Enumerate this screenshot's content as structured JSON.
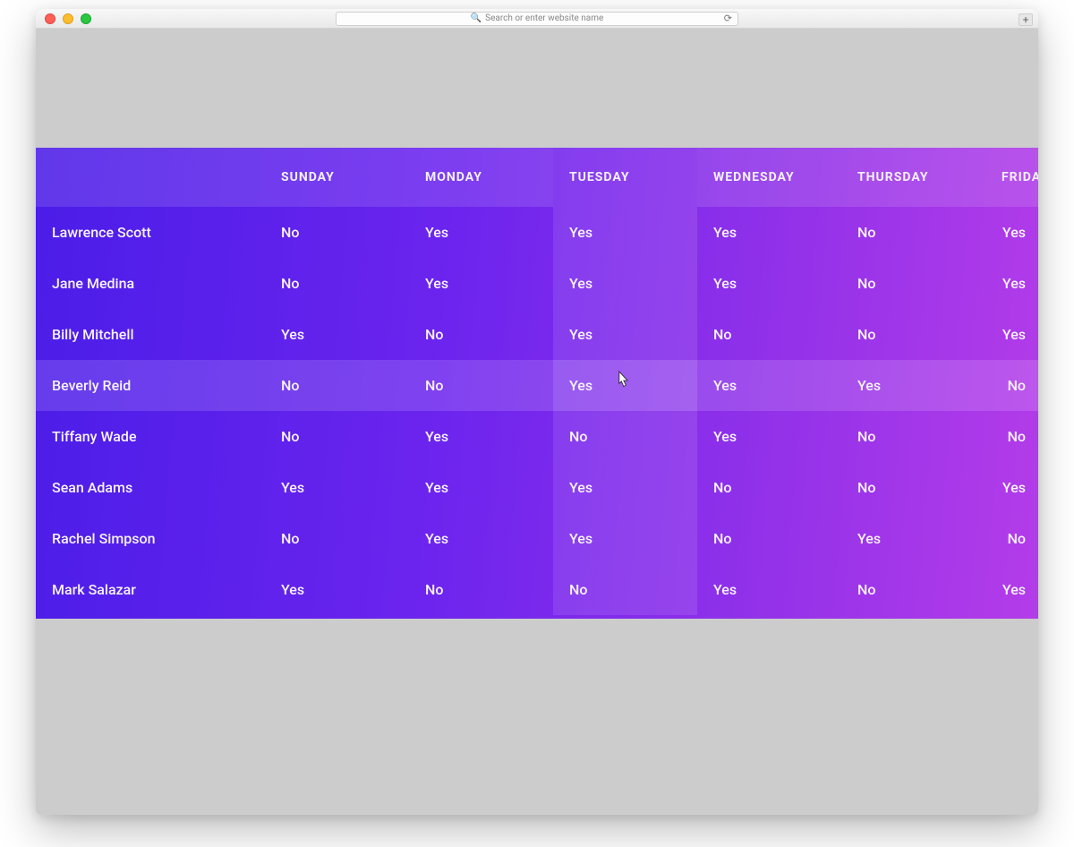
{
  "browser": {
    "url_placeholder": "Search or enter website name"
  },
  "table": {
    "highlighted_row_index": 3,
    "highlighted_col_index": 3,
    "headers": [
      "",
      "SUNDAY",
      "MONDAY",
      "TUESDAY",
      "WEDNESDAY",
      "THURSDAY",
      "FRIDAY"
    ],
    "rows": [
      {
        "name": "Lawrence Scott",
        "cells": [
          "No",
          "Yes",
          "Yes",
          "Yes",
          "No",
          "Yes"
        ]
      },
      {
        "name": "Jane Medina",
        "cells": [
          "No",
          "Yes",
          "Yes",
          "Yes",
          "No",
          "Yes"
        ]
      },
      {
        "name": "Billy Mitchell",
        "cells": [
          "Yes",
          "No",
          "Yes",
          "No",
          "No",
          "Yes"
        ]
      },
      {
        "name": "Beverly Reid",
        "cells": [
          "No",
          "No",
          "Yes",
          "Yes",
          "Yes",
          "No"
        ]
      },
      {
        "name": "Tiffany Wade",
        "cells": [
          "No",
          "Yes",
          "No",
          "Yes",
          "No",
          "No"
        ]
      },
      {
        "name": "Sean Adams",
        "cells": [
          "Yes",
          "Yes",
          "Yes",
          "No",
          "No",
          "Yes"
        ]
      },
      {
        "name": "Rachel Simpson",
        "cells": [
          "No",
          "Yes",
          "Yes",
          "No",
          "Yes",
          "No"
        ]
      },
      {
        "name": "Mark Salazar",
        "cells": [
          "Yes",
          "No",
          "No",
          "Yes",
          "No",
          "Yes"
        ]
      }
    ]
  }
}
